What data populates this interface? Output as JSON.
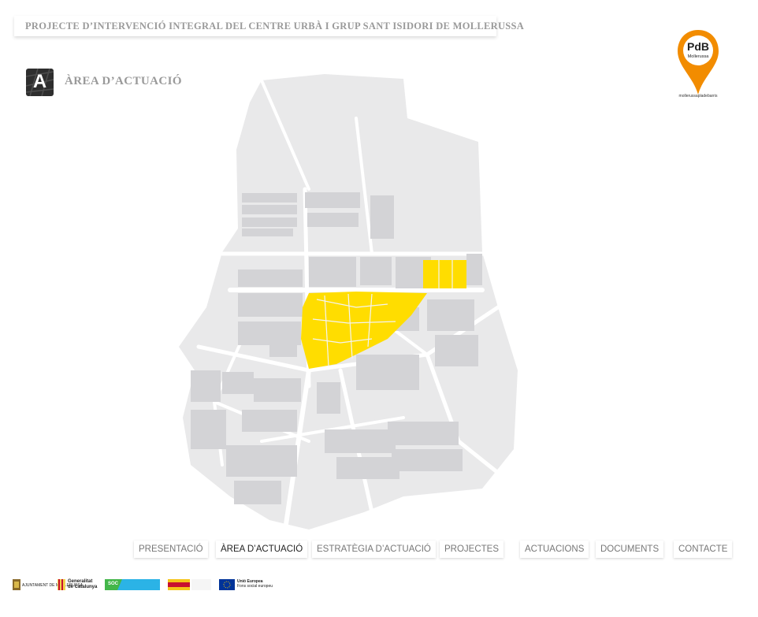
{
  "header": {
    "title": "PROJECTE D’INTERVENCIÓ INTEGRAL DEL CENTRE URBÀ I GRUP SANT ISIDORI DE MOLLERUSSA"
  },
  "section": {
    "icon_letter": "A",
    "title": "ÀREA D’ACTUACIÓ"
  },
  "logo": {
    "line1": "PdB",
    "line2": "Mollerussa",
    "domain": "mollerussapladebarris"
  },
  "map": {
    "highlight_color": "#FFDD00",
    "block_color": "#d3d3d6",
    "background_color": "#e9e9ea"
  },
  "nav": {
    "items": [
      {
        "label": "PRESENTACIÓ",
        "active": false
      },
      {
        "label": "ÀREA D’ACTUACIÓ",
        "active": true
      },
      {
        "label": "ESTRATÈGIA D’ACTUACIÓ",
        "active": false
      },
      {
        "label": "PROJECTES",
        "active": false
      },
      {
        "label": "ACTUACIONS",
        "active": false
      },
      {
        "label": "DOCUMENTS",
        "active": false
      },
      {
        "label": "CONTACTE",
        "active": false
      }
    ]
  },
  "footer": {
    "logos": [
      {
        "name": "ajuntament",
        "text": "AJUNTAMENT DE MOLLERUSSA"
      },
      {
        "name": "generalitat",
        "line1": "Generalitat",
        "line2": "de Catalunya"
      },
      {
        "name": "soc",
        "text": "SOC"
      },
      {
        "name": "gobierno",
        "text": ""
      },
      {
        "name": "ue",
        "line1": "Unió Europea",
        "line2": "Fons social europeu"
      }
    ]
  }
}
